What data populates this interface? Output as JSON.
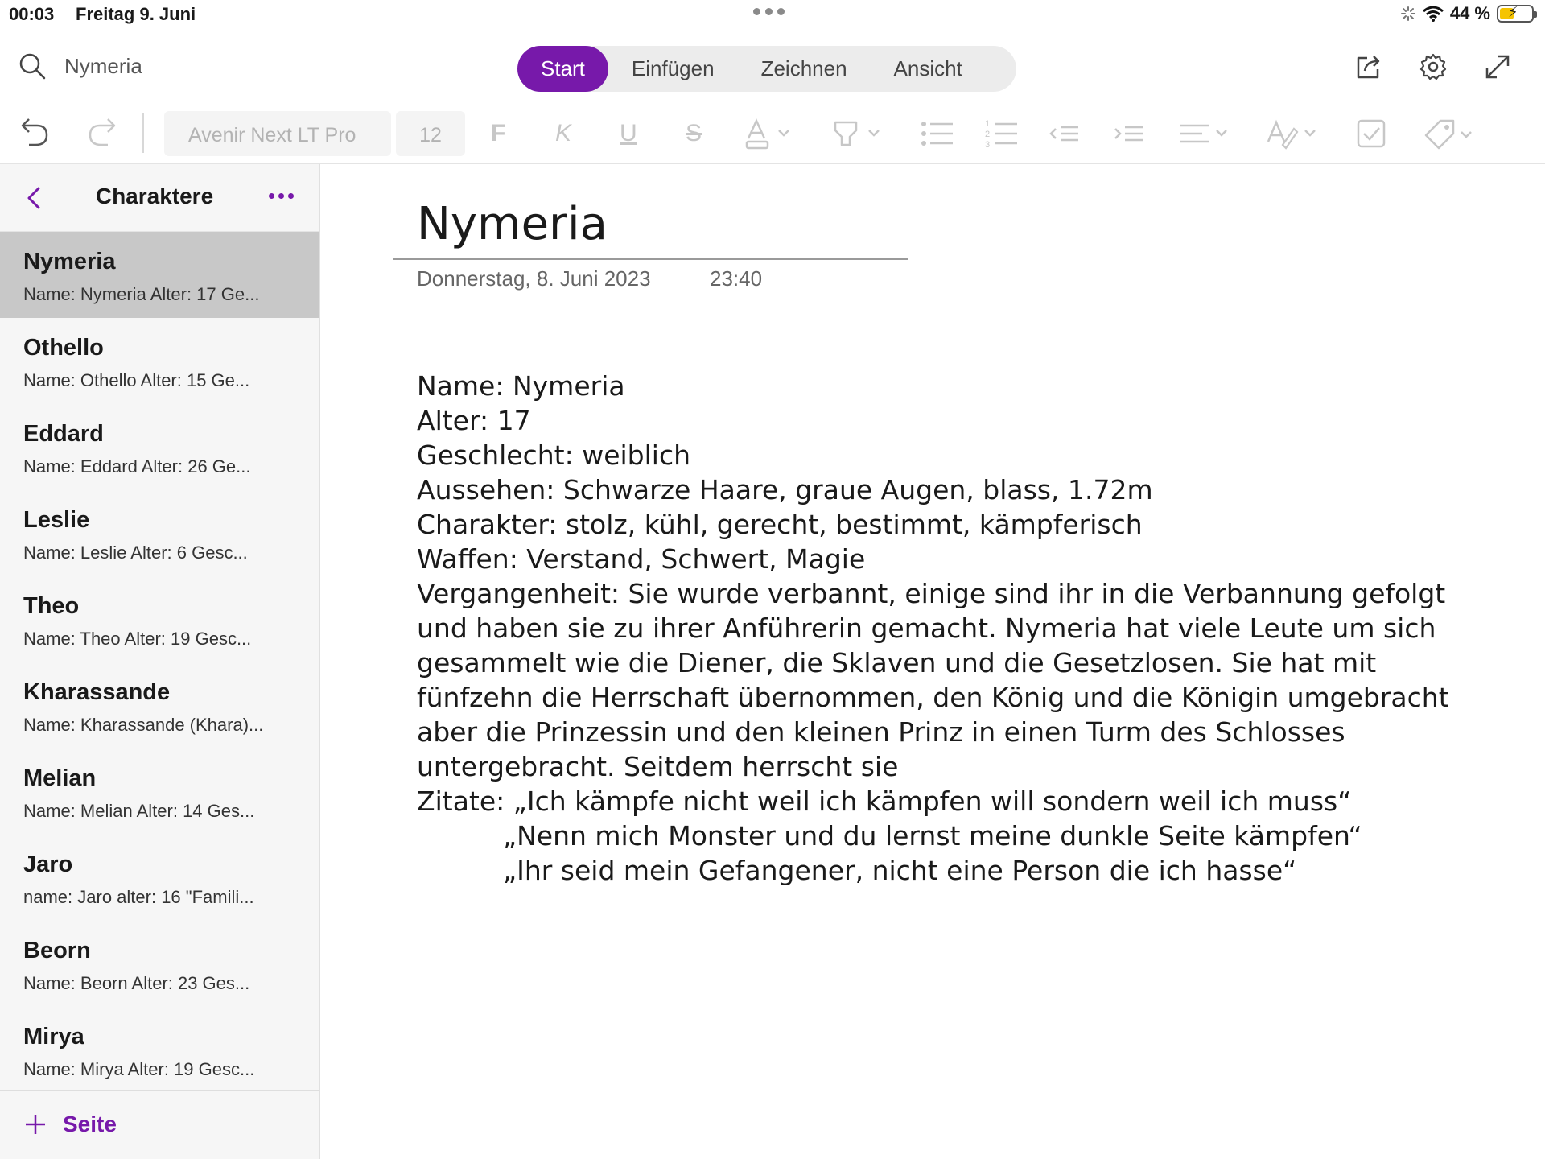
{
  "status": {
    "time": "00:03",
    "date": "Freitag 9. Juni",
    "battery": "44 %",
    "battery_level": 0.44
  },
  "search": {
    "value": "Nymeria"
  },
  "tabs": [
    "Start",
    "Einfügen",
    "Zeichnen",
    "Ansicht"
  ],
  "ribbon": {
    "font": "Avenir Next LT Pro",
    "size": "12"
  },
  "section": {
    "title": "Charaktere",
    "add_label": "Seite"
  },
  "pages": [
    {
      "title": "Nymeria",
      "snippet": "Name: Nymeria  Alter: 17  Ge..."
    },
    {
      "title": "Othello",
      "snippet": "Name: Othello  Alter: 15  Ge..."
    },
    {
      "title": "Eddard",
      "snippet": "Name: Eddard  Alter: 26  Ge..."
    },
    {
      "title": "Leslie",
      "snippet": "Name: Leslie  Alter: 6  Gesc..."
    },
    {
      "title": "Theo",
      "snippet": "Name: Theo  Alter: 19  Gesc..."
    },
    {
      "title": "Kharassande",
      "snippet": "Name: Kharassande (Khara)..."
    },
    {
      "title": "Melian",
      "snippet": "Name: Melian  Alter: 14  Ges..."
    },
    {
      "title": "Jaro",
      "snippet": "name: Jaro  alter: 16  \"Famili..."
    },
    {
      "title": "Beorn",
      "snippet": "Name: Beorn  Alter: 23  Ges..."
    },
    {
      "title": "Mirya",
      "snippet": "Name: Mirya  Alter: 19  Gesc..."
    }
  ],
  "note": {
    "title": "Nymeria",
    "date": "Donnerstag, 8. Juni 2023",
    "time": "23:40",
    "lines": [
      "Name: Nymeria",
      "Alter: 17",
      "Geschlecht: weiblich",
      "Aussehen: Schwarze Haare, graue Augen, blass, 1.72m",
      "Charakter: stolz, kühl, gerecht, bestimmt, kämpferisch",
      "Waffen: Verstand, Schwert, Magie",
      "Vergangenheit: Sie wurde verbannt, einige sind ihr in die Verbannung gefolgt",
      "und haben sie zu ihrer Anführerin gemacht. Nymeria hat viele Leute um sich",
      "gesammelt wie die Diener, die Sklaven und die Gesetzlosen. Sie hat mit",
      "fünfzehn die Herrschaft übernommen, den König und die Königin umgebracht",
      "aber die Prinzessin und den kleinen Prinz in einen Turm des Schlosses",
      "untergebracht. Seitdem herrscht sie",
      "Zitate: „Ich kämpfe nicht weil ich kämpfen will sondern weil ich muss“"
    ],
    "quotes": [
      "„Nenn mich Monster und du lernst meine dunkle Seite kämpfen“",
      "„Ihr seid mein Gefangener, nicht eine Person die ich hasse“"
    ]
  },
  "colors": {
    "accent": "#7719aa",
    "selected_page": "#c8c8c8",
    "sidebar_bg": "#f6f6f6"
  }
}
